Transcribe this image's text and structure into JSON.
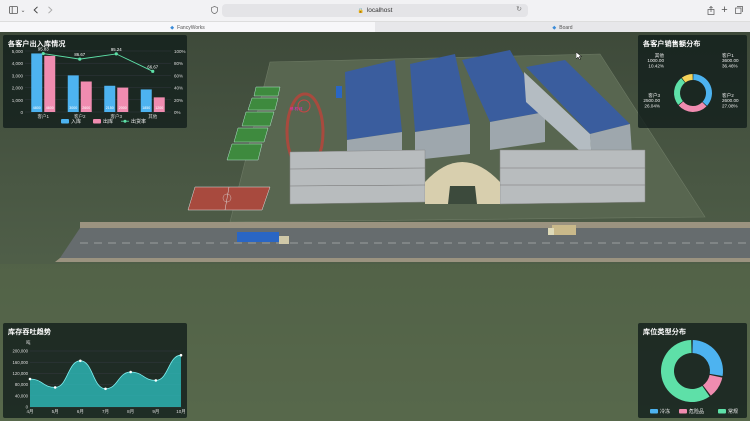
{
  "browser": {
    "url": "localhost",
    "tabs": [
      {
        "label": "FancyWorks",
        "active": true
      },
      {
        "label": "Board",
        "active": false
      }
    ]
  },
  "scene": {
    "helipad_label": "停 机 坪"
  },
  "panels": {
    "inout": {
      "title": "各客户出入库情况",
      "y_axis_left": [
        "5,000",
        "4,000",
        "3,000",
        "2,000",
        "1,000",
        "0"
      ],
      "y_axis_right": [
        "100%",
        "80%",
        "60%",
        "40%",
        "20%",
        "0%"
      ],
      "legend": [
        "入库",
        "出库",
        "出货率"
      ]
    },
    "sales": {
      "title": "各客户销售额分布"
    },
    "trend": {
      "title": "库存吞吐趋势",
      "unit": "吨",
      "y_axis": [
        "200,000",
        "160,000",
        "120,000",
        "80,000",
        "40,000",
        "0"
      ]
    },
    "storage": {
      "title": "库位类型分布",
      "legend": [
        "冷冻",
        "危险品",
        "常规"
      ]
    }
  },
  "chart_data": [
    {
      "type": "bar",
      "title": "各客户出入库情况",
      "categories": [
        "客户1",
        "客户2",
        "客户3",
        "其他"
      ],
      "series": [
        {
          "name": "入库",
          "values": [
            4800,
            3000,
            2150,
            1850
          ],
          "color": "#4db3f0"
        },
        {
          "name": "出库",
          "values": [
            4600,
            2500,
            2000,
            1200
          ],
          "color": "#f08cb0"
        },
        {
          "name": "出货率",
          "values": [
            95.83,
            86.67,
            95.24,
            66.67
          ],
          "color": "#5ee0a8",
          "line": true
        }
      ],
      "bar_labels_in": [
        "4800",
        "3000",
        "2150",
        "1850"
      ],
      "bar_labels_out": [
        "4600",
        "2600",
        "2000",
        "1200"
      ],
      "ylim": [
        0,
        5000
      ],
      "y2lim": [
        0,
        100
      ]
    },
    {
      "type": "pie",
      "title": "各客户销售额分布",
      "slices": [
        {
          "name": "客户1",
          "value": 3600,
          "percent": "36.46%",
          "color": "#4db3f0"
        },
        {
          "name": "客户2",
          "value": 2600,
          "percent": "27.08%",
          "color": "#f08cb0"
        },
        {
          "name": "客户3",
          "value": 2500,
          "percent": "26.04%",
          "color": "#5ee0a8"
        },
        {
          "name": "其他",
          "value": 1000,
          "percent": "10.42%",
          "color": "#f5d35a"
        }
      ],
      "labels": {
        "客户1": [
          "客户1",
          "3600.00",
          "36.46%"
        ],
        "客户2": [
          "客户2",
          "2600.00",
          "27.08%"
        ],
        "客户3": [
          "客户3",
          "2500.00",
          "26.04%"
        ],
        "其他": [
          "其他",
          "1000.00",
          "10.42%"
        ]
      }
    },
    {
      "type": "area",
      "title": "库存吞吐趋势",
      "categories": [
        "4月",
        "5月",
        "6月",
        "7月",
        "8月",
        "9月",
        "10月"
      ],
      "values": [
        100000,
        70000,
        165000,
        65000,
        125000,
        95000,
        185000
      ],
      "ylabel": "吨",
      "ylim": [
        0,
        200000
      ],
      "color": "#2fc6c6"
    },
    {
      "type": "pie",
      "title": "库位类型分布",
      "slices": [
        {
          "name": "冷冻",
          "value": 28,
          "color": "#4db3f0"
        },
        {
          "name": "危险品",
          "value": 12,
          "color": "#f08cb0"
        },
        {
          "name": "常规",
          "value": 60,
          "color": "#5ee0a8"
        }
      ]
    }
  ]
}
